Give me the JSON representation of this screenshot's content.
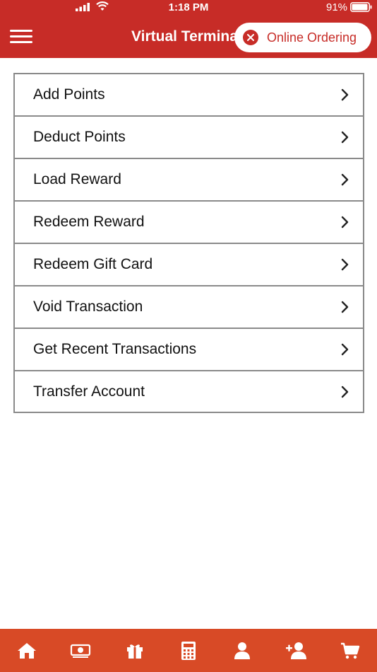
{
  "status_bar": {
    "time": "1:18 PM",
    "battery_percent": "91%"
  },
  "header": {
    "menu_icon": "hamburger-menu-icon",
    "title": "Virtual Terminal",
    "online_ordering_label": "Online Ordering",
    "online_ordering_icon": "close-circle-icon"
  },
  "menu": {
    "items": [
      {
        "label": "Add Points"
      },
      {
        "label": "Deduct Points"
      },
      {
        "label": "Load Reward"
      },
      {
        "label": "Redeem Reward"
      },
      {
        "label": "Redeem Gift Card"
      },
      {
        "label": "Void Transaction"
      },
      {
        "label": "Get Recent Transactions"
      },
      {
        "label": "Transfer Account"
      }
    ]
  },
  "tabbar": {
    "tabs": [
      {
        "icon": "home-icon"
      },
      {
        "icon": "money-icon"
      },
      {
        "icon": "gift-icon"
      },
      {
        "icon": "calculator-icon"
      },
      {
        "icon": "user-icon"
      },
      {
        "icon": "add-user-icon"
      },
      {
        "icon": "cart-icon"
      }
    ]
  },
  "colors": {
    "header_bg": "#c72c27",
    "tabbar_bg": "#d84a26",
    "border": "#8a8a8a"
  }
}
